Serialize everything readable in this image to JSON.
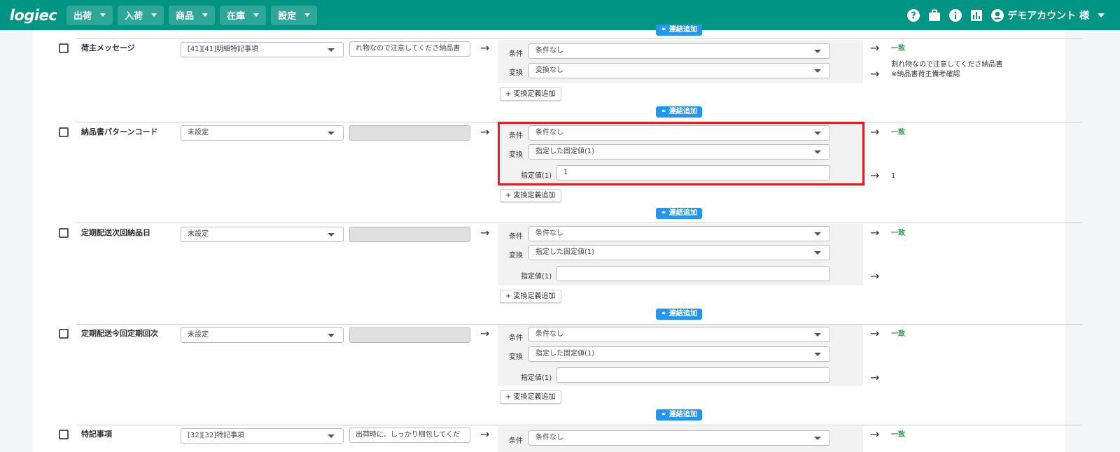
{
  "header": {
    "logo": "logiec",
    "nav": [
      {
        "label": "出荷"
      },
      {
        "label": "入荷"
      },
      {
        "label": "商品"
      },
      {
        "label": "在庫"
      },
      {
        "label": "設定"
      }
    ],
    "user": "デモアカウント 様"
  },
  "common": {
    "cond_label": "条件",
    "conv_label": "変換",
    "value_label": "指定値(1)",
    "add_def_label": "+ 変換定義追加",
    "link_add_label": "連結追加",
    "match_text": "一致"
  },
  "rows": [
    {
      "name": "荷主メッセージ",
      "source": "[41][41]明細特記事項",
      "sample": "れ物なので注意してくださ納品書",
      "condition": "条件なし",
      "conversion": "変換なし",
      "result_line1": "割れ物なので注意してくださ納品書",
      "result_line2": "※納品書荷主備考確認"
    },
    {
      "name": "納品書パターンコード",
      "source": "未設定",
      "sample": "",
      "condition": "条件なし",
      "conversion": "指定した固定値(1)",
      "value": "1",
      "result": "1"
    },
    {
      "name": "定期配送次回納品日",
      "source": "未設定",
      "sample": "",
      "condition": "条件なし",
      "conversion": "指定した固定値(1)",
      "value": ""
    },
    {
      "name": "定期配送今回定期回次",
      "source": "未設定",
      "sample": "",
      "condition": "条件なし",
      "conversion": "指定した固定値(1)",
      "value": ""
    },
    {
      "name": "特記事項",
      "source": "[32][32]特記事項",
      "sample": "出荷時に、しっかり梱包してくだ",
      "condition": "条件なし"
    }
  ]
}
